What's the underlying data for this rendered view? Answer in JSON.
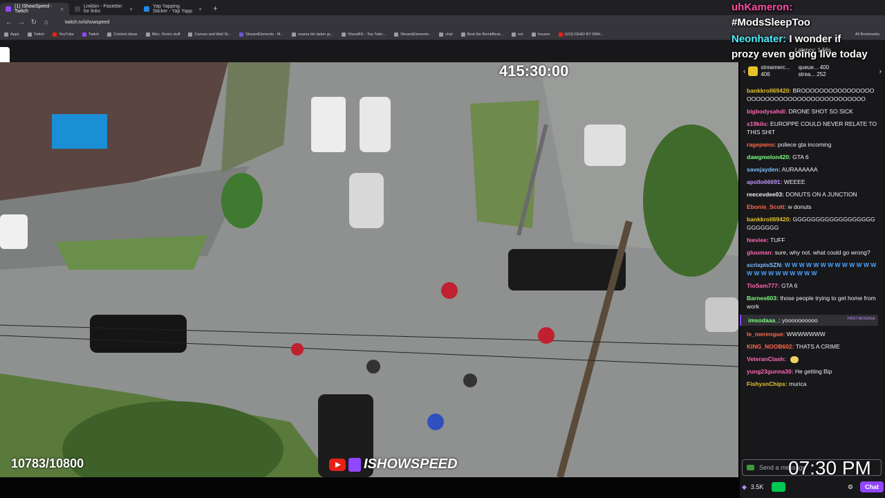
{
  "browser": {
    "tabs": [
      {
        "title": "(1) IShowSpeed - Twitch",
        "color": "#9146ff"
      },
      {
        "title": "Linkbin - Pastebin for links",
        "color": "#333333"
      },
      {
        "title": "Yap Yapping Sticker - Yap Yapp",
        "color": "#1e88e5"
      }
    ],
    "new_tab": "+",
    "url": "twitch.tv/ishowspeed",
    "bookmarks": [
      "Apps",
      "Twitch",
      "YouTube",
      "Twitch",
      "Content Ideas",
      "Misc. Room stuff",
      "Canvas and Wall St...",
      "StreamElements - M...",
      "osama bin laden gr...",
      "SheedFE - Top Twitc...",
      "StreamElements -",
      "chat",
      "Beat the BombBeat...",
      "oor",
      "houses",
      "(103) DEAD BY DAN..."
    ],
    "all_bookmarks": "All Bookmarks"
  },
  "overlay": {
    "timer": "415:30:00",
    "counter": "10783/10800",
    "brand": "ISHOWSPEED",
    "clock": "07:30 PM",
    "captions": [
      {
        "user": "uhKameron:",
        "text": ""
      },
      {
        "user": "#ModsSleepToo",
        "text": ""
      },
      {
        "user": "Neonhater:",
        "text": "I wonder if"
      },
      {
        "user": "",
        "text": "prozy even going live today"
      }
    ],
    "latency": "Latency: 1.56s"
  },
  "chat": {
    "subs": [
      {
        "name": "queue...",
        "count": "400"
      },
      {
        "name": "strea...",
        "count": "252"
      },
      {
        "name": "streamerc...",
        "count": "406"
      }
    ],
    "messages": [
      {
        "user": "bankkroll69420:",
        "color": "#e6c229",
        "text": "BROOOOOOOOOOOOOOOOOOOOOOOOOOOOOOOOOOOOOOOOOO"
      },
      {
        "user": "bigbodysahdi:",
        "color": "#ff69b4",
        "text": "DRONE SHOT SO SICK"
      },
      {
        "user": "x19kilo:",
        "color": "#ff69b4",
        "text": "EUROPPE COULD NEVER RELATE TO THIS SHIT"
      },
      {
        "user": "ragepwns:",
        "color": "#ff6a4d",
        "text": "poliece gta incoming"
      },
      {
        "user": "dawgmelon420:",
        "color": "#7fff7f",
        "text": "GTA 6"
      },
      {
        "user": "savejayden:",
        "color": "#7fbfff",
        "text": "AURAAAAAA"
      },
      {
        "user": "apollo66691:",
        "color": "#bf94ff",
        "text": "WEEEE"
      },
      {
        "user": "reecevdee03:",
        "color": "#efeff1",
        "text": "DONUTS ON A JUNCTION"
      },
      {
        "user": "Ebonie_Scott:",
        "color": "#ff6a4d",
        "text": "w donuts"
      },
      {
        "user": "bankkroll69420:",
        "color": "#e6c229",
        "text": "GGGGGGGGGGGGGGGGGGGGGGGGG"
      },
      {
        "user": "feeviee:",
        "color": "#ff69b4",
        "text": "TUFF"
      },
      {
        "user": "gluuman:",
        "color": "#ff69b4",
        "text": "sure, why not. what could go wrong?"
      },
      {
        "user": "scrixptsSZN:",
        "color": "#7fbfff",
        "text": "W W W W W W W W W W W W W W W W W W W W W W W"
      },
      {
        "user": "TioSam777:",
        "color": "#ff69b4",
        "text": "GTA 6"
      },
      {
        "user": "Barnes603:",
        "color": "#7fff7f",
        "text": "those people trying to get home from work"
      },
      {
        "user": "imsodaaa_:",
        "color": "#7fff7f",
        "text": "yoooooooooo",
        "first_message": "FIRST MESSAGE"
      },
      {
        "user": "le_merengue:",
        "color": "#ff6a4d",
        "text": "WWWWWWW"
      },
      {
        "user": "KING_NOOB602:",
        "color": "#ff6a4d",
        "text": "THATS A CRIME"
      },
      {
        "user": "VeteranClash:",
        "color": "#ff69b4",
        "text": ""
      },
      {
        "user": "yung23gunna30:",
        "color": "#ff69b4",
        "text": "He getting Bip"
      },
      {
        "user": "FishysnChips:",
        "color": "#e6c229",
        "text": "murica"
      }
    ],
    "send_placeholder": "Send a message",
    "viewers": "3.5K",
    "chat_button": "Chat"
  }
}
